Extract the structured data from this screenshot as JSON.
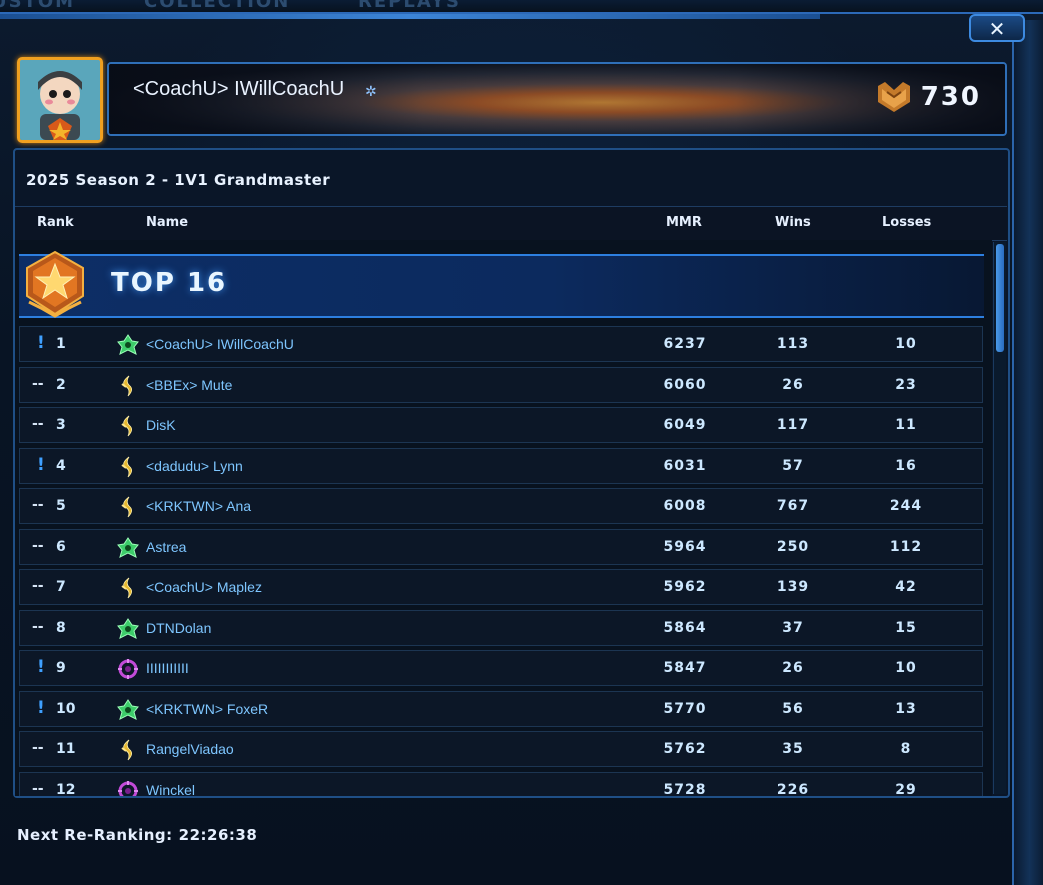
{
  "window": {
    "background_tabs": [
      "USTOM",
      "COLLECTION",
      "REPLAYS"
    ],
    "close_label": "✕"
  },
  "profile": {
    "name": "<CoachU> IWillCoachU",
    "points": "730"
  },
  "ladder": {
    "season_title": "2025 Season 2 - 1V1 Grandmaster",
    "columns": {
      "rank": "Rank",
      "name": "Name",
      "mmr": "MMR",
      "wins": "Wins",
      "losses": "Losses"
    },
    "section_label": "TOP 16",
    "rows": [
      {
        "status": "!",
        "rank": "1",
        "race": "terran-icon",
        "name": "<CoachU> IWillCoachU",
        "mmr": "6237",
        "wins": "113",
        "losses": "10"
      },
      {
        "status": "--",
        "rank": "2",
        "race": "protoss-icon",
        "name": "<BBEx> Mute",
        "mmr": "6060",
        "wins": "26",
        "losses": "23"
      },
      {
        "status": "--",
        "rank": "3",
        "race": "protoss-icon",
        "name": "DisK",
        "mmr": "6049",
        "wins": "117",
        "losses": "11"
      },
      {
        "status": "!",
        "rank": "4",
        "race": "protoss-icon",
        "name": "<dadudu> Lynn",
        "mmr": "6031",
        "wins": "57",
        "losses": "16"
      },
      {
        "status": "--",
        "rank": "5",
        "race": "protoss-icon",
        "name": "<KRKTWN> Ana",
        "mmr": "6008",
        "wins": "767",
        "losses": "244"
      },
      {
        "status": "--",
        "rank": "6",
        "race": "terran-icon",
        "name": "Astrea",
        "mmr": "5964",
        "wins": "250",
        "losses": "112"
      },
      {
        "status": "--",
        "rank": "7",
        "race": "protoss-icon",
        "name": "<CoachU> Maplez",
        "mmr": "5962",
        "wins": "139",
        "losses": "42"
      },
      {
        "status": "--",
        "rank": "8",
        "race": "terran-icon",
        "name": "DTNDolan",
        "mmr": "5864",
        "wins": "37",
        "losses": "15"
      },
      {
        "status": "!",
        "rank": "9",
        "race": "zerg-icon",
        "name": "IIIIIIIIIII",
        "mmr": "5847",
        "wins": "26",
        "losses": "10"
      },
      {
        "status": "!",
        "rank": "10",
        "race": "terran-icon",
        "name": "<KRKTWN> FoxeR",
        "mmr": "5770",
        "wins": "56",
        "losses": "13"
      },
      {
        "status": "--",
        "rank": "11",
        "race": "protoss-icon",
        "name": "RangelViadao",
        "mmr": "5762",
        "wins": "35",
        "losses": "8"
      },
      {
        "status": "--",
        "rank": "12",
        "race": "zerg-icon",
        "name": "Winckel",
        "mmr": "5728",
        "wins": "226",
        "losses": "29"
      }
    ]
  },
  "footer": {
    "label": "Next Re-Ranking:",
    "countdown": "22:26:38"
  },
  "colors": {
    "accent": "#2d7fe0",
    "name_link": "#7ec6ff",
    "portrait_border": "#f0a020"
  }
}
